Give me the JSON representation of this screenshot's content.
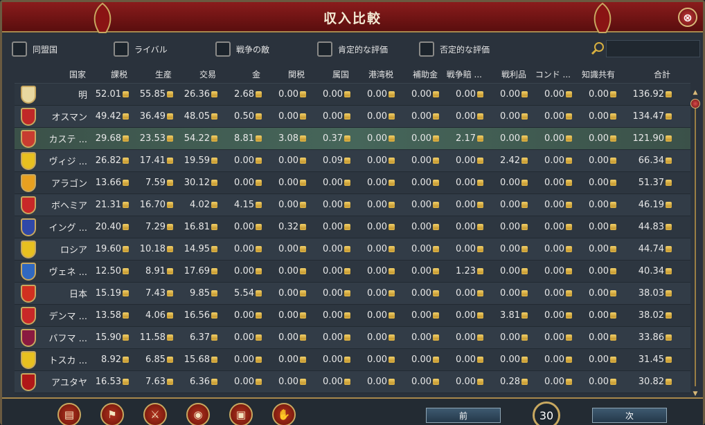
{
  "title": "収入比較",
  "close_label": "⊗",
  "filters": [
    {
      "label": "同盟国"
    },
    {
      "label": "ライバル"
    },
    {
      "label": "戦争の敵"
    },
    {
      "label": "肯定的な評価"
    },
    {
      "label": "否定的な評価"
    }
  ],
  "search": {
    "placeholder": ""
  },
  "headers": [
    "国家",
    "課税",
    "生産",
    "交易",
    "金",
    "関税",
    "属国",
    "港湾税",
    "補助金",
    "戦争賠 ...",
    "戦利品",
    "コンド ...",
    "知識共有",
    "合計"
  ],
  "rows": [
    {
      "name": "明",
      "flag_color": "#e8d8a0",
      "values": [
        "52.01",
        "55.85",
        "26.36",
        "2.68",
        "0.00",
        "0.00",
        "0.00",
        "0.00",
        "0.00",
        "0.00",
        "0.00",
        "0.00",
        "136.92"
      ]
    },
    {
      "name": "オスマン",
      "flag_color": "#c02828",
      "values": [
        "49.42",
        "36.49",
        "48.05",
        "0.50",
        "0.00",
        "0.00",
        "0.00",
        "0.00",
        "0.00",
        "0.00",
        "0.00",
        "0.00",
        "134.47"
      ]
    },
    {
      "name": "カステ ...",
      "flag_color": "#c83c30",
      "values": [
        "29.68",
        "23.53",
        "54.22",
        "8.81",
        "3.08",
        "0.37",
        "0.00",
        "0.00",
        "2.17",
        "0.00",
        "0.00",
        "0.00",
        "121.90"
      ],
      "highlight": true
    },
    {
      "name": "ヴィジ ...",
      "flag_color": "#e8c020",
      "values": [
        "26.82",
        "17.41",
        "19.59",
        "0.00",
        "0.00",
        "0.09",
        "0.00",
        "0.00",
        "0.00",
        "2.42",
        "0.00",
        "0.00",
        "66.34"
      ]
    },
    {
      "name": "アラゴン",
      "flag_color": "#e8a020",
      "values": [
        "13.66",
        "7.59",
        "30.12",
        "0.00",
        "0.00",
        "0.00",
        "0.00",
        "0.00",
        "0.00",
        "0.00",
        "0.00",
        "0.00",
        "51.37"
      ]
    },
    {
      "name": "ボヘミア",
      "flag_color": "#c82828",
      "values": [
        "21.31",
        "16.70",
        "4.02",
        "4.15",
        "0.00",
        "0.00",
        "0.00",
        "0.00",
        "0.00",
        "0.00",
        "0.00",
        "0.00",
        "46.19"
      ]
    },
    {
      "name": "イング ...",
      "flag_color": "#3048a8",
      "values": [
        "20.40",
        "7.29",
        "16.81",
        "0.00",
        "0.32",
        "0.00",
        "0.00",
        "0.00",
        "0.00",
        "0.00",
        "0.00",
        "0.00",
        "44.83"
      ]
    },
    {
      "name": "ロシア",
      "flag_color": "#e8c020",
      "values": [
        "19.60",
        "10.18",
        "14.95",
        "0.00",
        "0.00",
        "0.00",
        "0.00",
        "0.00",
        "0.00",
        "0.00",
        "0.00",
        "0.00",
        "44.74"
      ]
    },
    {
      "name": "ヴェネ ...",
      "flag_color": "#3068c0",
      "values": [
        "12.50",
        "8.91",
        "17.69",
        "0.00",
        "0.00",
        "0.00",
        "0.00",
        "0.00",
        "1.23",
        "0.00",
        "0.00",
        "0.00",
        "40.34"
      ]
    },
    {
      "name": "日本",
      "flag_color": "#d03020",
      "values": [
        "15.19",
        "7.43",
        "9.85",
        "5.54",
        "0.00",
        "0.00",
        "0.00",
        "0.00",
        "0.00",
        "0.00",
        "0.00",
        "0.00",
        "38.03"
      ]
    },
    {
      "name": "デンマ ...",
      "flag_color": "#c82828",
      "values": [
        "13.58",
        "4.06",
        "16.56",
        "0.00",
        "0.00",
        "0.00",
        "0.00",
        "0.00",
        "0.00",
        "3.81",
        "0.00",
        "0.00",
        "38.02"
      ]
    },
    {
      "name": "バフマ ...",
      "flag_color": "#8a1a40",
      "values": [
        "15.90",
        "11.58",
        "6.37",
        "0.00",
        "0.00",
        "0.00",
        "0.00",
        "0.00",
        "0.00",
        "0.00",
        "0.00",
        "0.00",
        "33.86"
      ]
    },
    {
      "name": "トスカ ...",
      "flag_color": "#e8c020",
      "values": [
        "8.92",
        "6.85",
        "15.68",
        "0.00",
        "0.00",
        "0.00",
        "0.00",
        "0.00",
        "0.00",
        "0.00",
        "0.00",
        "0.00",
        "31.45"
      ]
    },
    {
      "name": "アユタヤ",
      "flag_color": "#b01818",
      "values": [
        "16.53",
        "7.63",
        "6.36",
        "0.00",
        "0.00",
        "0.00",
        "0.00",
        "0.00",
        "0.00",
        "0.28",
        "0.00",
        "0.00",
        "30.82"
      ]
    }
  ],
  "footer": {
    "prev_label": "前",
    "next_label": "次",
    "page": "30"
  },
  "icons": [
    "ledger-icon",
    "flag-icon",
    "crossed-swords-icon",
    "coins-icon",
    "chest-icon",
    "handshake-icon"
  ]
}
